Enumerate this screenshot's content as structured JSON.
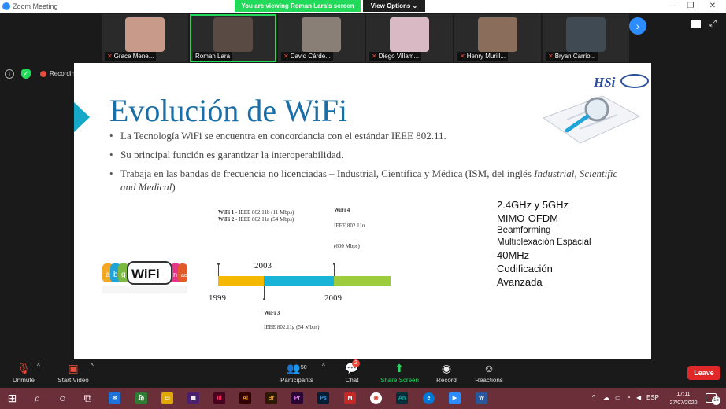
{
  "window": {
    "title": "Zoom Meeting",
    "viewing_banner": "You are viewing Roman Lara's screen",
    "view_options": "View Options ⌄"
  },
  "participants": [
    {
      "name": "Grace Mene..."
    },
    {
      "name": "Roman Lara"
    },
    {
      "name": "David Cárde..."
    },
    {
      "name": "Diego Villam..."
    },
    {
      "name": "Henry Murill..."
    },
    {
      "name": "Bryan Carrio..."
    }
  ],
  "status": {
    "recording_label": "Recordin"
  },
  "slide": {
    "title": "Evolución de WiFi",
    "logo_text": "HSi",
    "bullets": [
      {
        "text": "La Tecnología WiFi se encuentra en concordancia con el estándar IEEE 802.11."
      },
      {
        "text": "Su principal función es garantizar la interoperabilidad."
      },
      {
        "text": "Trabaja en las bandas de frecuencia no licenciadas – Industrial, Científica y Médica (ISM, del inglés ",
        "italic": "Industrial, Scientific and Medical",
        "tail": ")"
      }
    ],
    "specs": [
      "2.4GHz y 5GHz",
      "MIMO-OFDM",
      "Beamforming",
      "Multiplexación Espacial",
      "40MHz",
      "Codificación",
      "Avanzada"
    ],
    "timeline": {
      "wifi1_label": "WiFi 1",
      "wifi1_spec": " - IEEE 802.11b (11 Mbps)",
      "wifi2_label": "WiFi 2",
      "wifi2_spec": " - IEEE 802.11a (54 Mbps)",
      "wifi4_label": "WiFi 4",
      "wifi4_spec": "IEEE 802.11n",
      "wifi4_speed": "(600 Mbps)",
      "wifi3_label": "WiFi 3",
      "wifi3_spec": "IEEE 802.11g (54 Mbps)",
      "year_1999": "1999",
      "year_2003": "2003",
      "year_2009": "2009",
      "colors": {
        "seg1": "#f5b800",
        "seg2": "#18b4d8",
        "seg3": "#9ccb3b"
      }
    },
    "wifi_logo": {
      "letters": [
        "a",
        "b",
        "g"
      ],
      "center": "WiFi",
      "right": "n",
      "ac": "ac"
    }
  },
  "toolbar": {
    "unmute": "Unmute",
    "start_video": "Start Video",
    "participants": "Participants",
    "participants_count": "50",
    "chat": "Chat",
    "chat_badge": "2",
    "share_screen": "Share Screen",
    "record": "Record",
    "reactions": "Reactions",
    "leave": "Leave"
  },
  "taskbar": {
    "lang": "ESP",
    "time": "17:11",
    "date": "27/07/2020",
    "notif_count": "15",
    "app_badges": {
      "ps": "Ps",
      "id": "Id",
      "ai": "Ai",
      "br": "Br",
      "pr": "Pr",
      "an": "An",
      "w": "W",
      "lr": "Lr"
    }
  },
  "colors": {
    "accent": "#2d8cff",
    "share_green": "#23d959",
    "leave_red": "#e02828",
    "slide_title": "#1b6fa6",
    "taskbar": "#6b2f3a"
  }
}
